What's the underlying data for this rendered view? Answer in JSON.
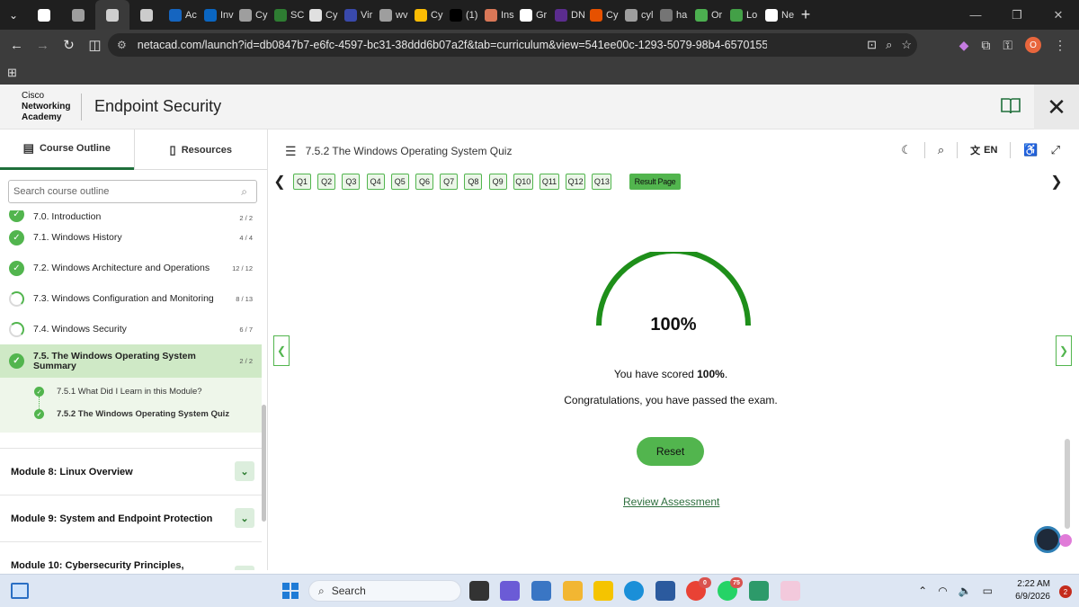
{
  "browser": {
    "tabs": [
      {
        "label": "",
        "icon": "github-icon",
        "color": "#ffffff"
      },
      {
        "label": "",
        "icon": "page-icon",
        "color": "#9e9e9e"
      },
      {
        "label": "",
        "icon": "netacad-icon",
        "color": "#cfcfcf",
        "active": true
      },
      {
        "label": "",
        "icon": "doc-icon",
        "color": "#cccccc"
      },
      {
        "label": "Ac",
        "icon": "c-icon",
        "color": "#1565c0"
      },
      {
        "label": "Inv",
        "icon": "linkedin-icon",
        "color": "#0a66c2"
      },
      {
        "label": "Cy",
        "icon": "globe-icon",
        "color": "#9e9e9e"
      },
      {
        "label": "SC",
        "icon": "w-icon",
        "color": "#2e7d32"
      },
      {
        "label": "Cy",
        "icon": "tophat-icon",
        "color": "#e0e0e0"
      },
      {
        "label": "Vir",
        "icon": "virustotal-icon",
        "color": "#3949ab"
      },
      {
        "label": "wv",
        "icon": "globe-icon",
        "color": "#9e9e9e"
      },
      {
        "label": "Cy",
        "icon": "drive-icon",
        "color": "#fbbc04"
      },
      {
        "label": "(1)",
        "icon": "x-icon",
        "color": "#000000"
      },
      {
        "label": "Ins",
        "icon": "claude-icon",
        "color": "#d97757"
      },
      {
        "label": "Gr",
        "icon": "openai-icon",
        "color": "#ffffff"
      },
      {
        "label": "DN",
        "icon": "n-icon",
        "color": "#5b2c8e"
      },
      {
        "label": "Cy",
        "icon": "terminal-icon",
        "color": "#e65100"
      },
      {
        "label": "cyl",
        "icon": "globe-icon",
        "color": "#9e9e9e"
      },
      {
        "label": "ha",
        "icon": "page-icon",
        "color": "#757575"
      },
      {
        "label": "Or",
        "icon": "colorful-icon",
        "color": "#4caf50"
      },
      {
        "label": "Lo",
        "icon": "two-icon",
        "color": "#43a047"
      },
      {
        "label": "Ne",
        "icon": "mk-icon",
        "color": "#ffffff"
      }
    ],
    "url": "netacad.com/launch?id=db0847b7-e6fc-4597-bc31-38ddd6b07a2f&tab=curriculum&view=541ee00c-1293-5079-98b4-657015579869",
    "profile_initial": "O"
  },
  "header": {
    "logo_line1": "Cisco",
    "logo_line2": "Networking",
    "logo_line3": "Academy",
    "course_title": "Endpoint Security"
  },
  "sidebar": {
    "tab_outline": "Course Outline",
    "tab_resources": "Resources",
    "search_placeholder": "Search course outline",
    "partial_item": {
      "label": "7.0. Introduction",
      "count": "2 / 2"
    },
    "items": [
      {
        "label": "7.1. Windows History",
        "count": "4 / 4",
        "status": "done"
      },
      {
        "label": "7.2. Windows Architecture and Operations",
        "count": "12 / 12",
        "status": "done"
      },
      {
        "label": "7.3. Windows Configuration and Monitoring",
        "count": "8 / 13",
        "status": "progress"
      },
      {
        "label": "7.4. Windows Security",
        "count": "6 / 7",
        "status": "progress"
      }
    ],
    "current": {
      "label": "7.5. The Windows Operating System Summary",
      "count": "2 / 2"
    },
    "subitems": [
      {
        "label": "7.5.1 What Did I Learn in this Module?"
      },
      {
        "label": "7.5.2 The Windows Operating System Quiz"
      }
    ],
    "modules": [
      {
        "label": "Module 8: Linux Overview"
      },
      {
        "label": "Module 9: System and Endpoint Protection"
      },
      {
        "label": "Module 10: Cybersecurity Principles,"
      }
    ]
  },
  "main": {
    "page_title": "7.5.2 The Windows Operating System Quiz",
    "lang": "EN",
    "questions": [
      "Q1",
      "Q2",
      "Q3",
      "Q4",
      "Q5",
      "Q6",
      "Q7",
      "Q8",
      "Q9",
      "Q10",
      "Q11",
      "Q12",
      "Q13"
    ],
    "result_label": "Result Page",
    "score_percent": "100%",
    "score_fraction": 1.0,
    "score_prefix": "You have scored ",
    "score_value": "100%",
    "score_suffix": ".",
    "congrats": "Congratulations, you have passed the exam.",
    "reset_label": "Reset",
    "review_label": "Review Assessment",
    "accent_color": "#52b54e"
  },
  "taskbar": {
    "search_label": "Search",
    "time": "2:22 AM",
    "date": "6/9/2026",
    "notification_count": "2",
    "whatsapp_badge": "75",
    "chrome_badge": "0"
  }
}
